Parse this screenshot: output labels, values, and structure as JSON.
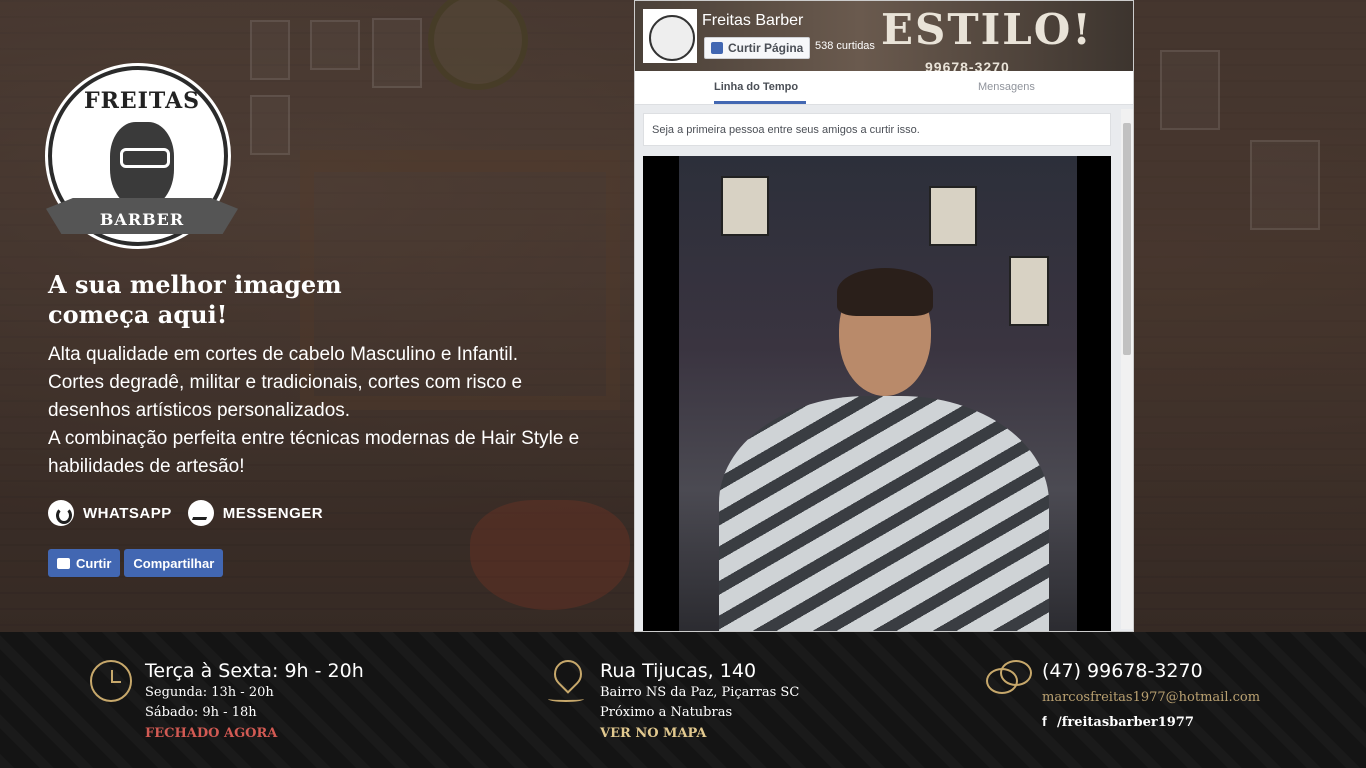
{
  "logo": {
    "top_text": "FREITAS",
    "bottom_text": "BARBER"
  },
  "hero": {
    "headline_line1": "A sua melhor imagem",
    "headline_line2": "começa aqui!",
    "desc": [
      "Alta qualidade em cortes de cabelo Masculino e Infantil.",
      "Cortes degradê, militar e tradicionais, cortes com risco e desenhos artísticos personalizados.",
      "A combinação perfeita entre técnicas modernas de Hair Style e habilidades de artesão!"
    ]
  },
  "contacts": {
    "whatsapp": "WHATSAPP",
    "messenger": "MESSENGER"
  },
  "social": {
    "like": "Curtir",
    "share": "Compartilhar"
  },
  "fb_widget": {
    "cover_text": "ESTILO!",
    "cover_phone": "99678-3270",
    "page_name": "Freitas Barber",
    "like_button": "Curtir Página",
    "likes_count": "538 curtidas",
    "tab_timeline": "Linha do Tempo",
    "tab_messages": "Mensagens",
    "friends_note": "Seja a primeira pessoa entre seus amigos a curtir isso."
  },
  "footer": {
    "hours": {
      "title": "Terça à Sexta: 9h - 20h",
      "line1": "Segunda: 13h - 20h",
      "line2": "Sábado: 9h - 18h",
      "status": "FECHADO AGORA"
    },
    "address": {
      "title": "Rua Tijucas, 140",
      "line1": "Bairro NS da Paz, Piçarras SC",
      "line2": "Próximo a Natubras",
      "map_link": "VER NO MAPA"
    },
    "contact": {
      "phone": "(47) 99678-3270",
      "email": "marcosfreitas1977@hotmail.com",
      "facebook": "/freitasbarber1977"
    }
  },
  "colors": {
    "accent_gold": "#c7a86b",
    "status_red": "#d25a53",
    "fb_blue": "#4267b2"
  }
}
